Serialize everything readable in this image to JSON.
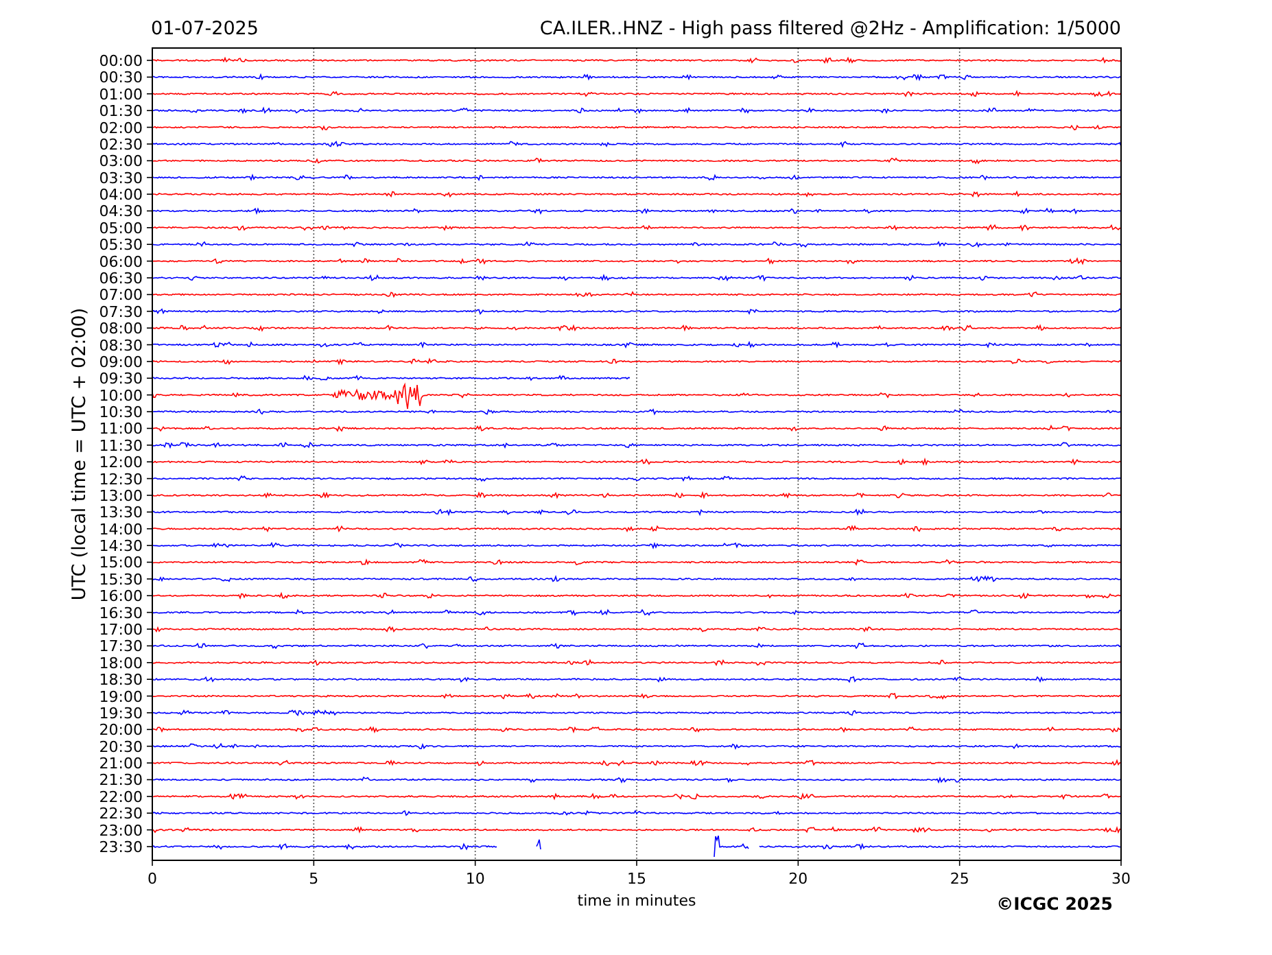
{
  "date": "01-07-2025",
  "title": "CA.ILER..HNZ - High pass filtered @2Hz - Amplification: 1/5000",
  "ylabel": "UTC (local time = UTC + 02:00)",
  "xlabel": "time in minutes",
  "xticks": [
    "0",
    "5",
    "10",
    "15",
    "20",
    "25",
    "30"
  ],
  "copyright": "©ICGC 2025",
  "traces": [
    {
      "label": "00:00",
      "color": "#ff0000"
    },
    {
      "label": "00:30",
      "color": "#0000ff"
    },
    {
      "label": "01:00",
      "color": "#ff0000"
    },
    {
      "label": "01:30",
      "color": "#0000ff"
    },
    {
      "label": "02:00",
      "color": "#ff0000"
    },
    {
      "label": "02:30",
      "color": "#0000ff"
    },
    {
      "label": "03:00",
      "color": "#ff0000"
    },
    {
      "label": "03:30",
      "color": "#0000ff"
    },
    {
      "label": "04:00",
      "color": "#ff0000"
    },
    {
      "label": "04:30",
      "color": "#0000ff"
    },
    {
      "label": "05:00",
      "color": "#ff0000"
    },
    {
      "label": "05:30",
      "color": "#0000ff"
    },
    {
      "label": "06:00",
      "color": "#ff0000"
    },
    {
      "label": "06:30",
      "color": "#0000ff"
    },
    {
      "label": "07:00",
      "color": "#ff0000"
    },
    {
      "label": "07:30",
      "color": "#0000ff"
    },
    {
      "label": "08:00",
      "color": "#ff0000"
    },
    {
      "label": "08:30",
      "color": "#0000ff"
    },
    {
      "label": "09:00",
      "color": "#ff0000"
    },
    {
      "label": "09:30",
      "color": "#0000ff"
    },
    {
      "label": "10:00",
      "color": "#ff0000"
    },
    {
      "label": "10:30",
      "color": "#0000ff"
    },
    {
      "label": "11:00",
      "color": "#ff0000"
    },
    {
      "label": "11:30",
      "color": "#0000ff"
    },
    {
      "label": "12:00",
      "color": "#ff0000"
    },
    {
      "label": "12:30",
      "color": "#0000ff"
    },
    {
      "label": "13:00",
      "color": "#ff0000"
    },
    {
      "label": "13:30",
      "color": "#0000ff"
    },
    {
      "label": "14:00",
      "color": "#ff0000"
    },
    {
      "label": "14:30",
      "color": "#0000ff"
    },
    {
      "label": "15:00",
      "color": "#ff0000"
    },
    {
      "label": "15:30",
      "color": "#0000ff"
    },
    {
      "label": "16:00",
      "color": "#ff0000"
    },
    {
      "label": "16:30",
      "color": "#0000ff"
    },
    {
      "label": "17:00",
      "color": "#ff0000"
    },
    {
      "label": "17:30",
      "color": "#0000ff"
    },
    {
      "label": "18:00",
      "color": "#ff0000"
    },
    {
      "label": "18:30",
      "color": "#0000ff"
    },
    {
      "label": "19:00",
      "color": "#ff0000"
    },
    {
      "label": "19:30",
      "color": "#0000ff"
    },
    {
      "label": "20:00",
      "color": "#ff0000"
    },
    {
      "label": "20:30",
      "color": "#0000ff"
    },
    {
      "label": "21:00",
      "color": "#ff0000"
    },
    {
      "label": "21:30",
      "color": "#0000ff"
    },
    {
      "label": "22:00",
      "color": "#ff0000"
    },
    {
      "label": "22:30",
      "color": "#0000ff"
    },
    {
      "label": "23:00",
      "color": "#ff0000"
    },
    {
      "label": "23:30",
      "color": "#0000ff"
    }
  ]
}
